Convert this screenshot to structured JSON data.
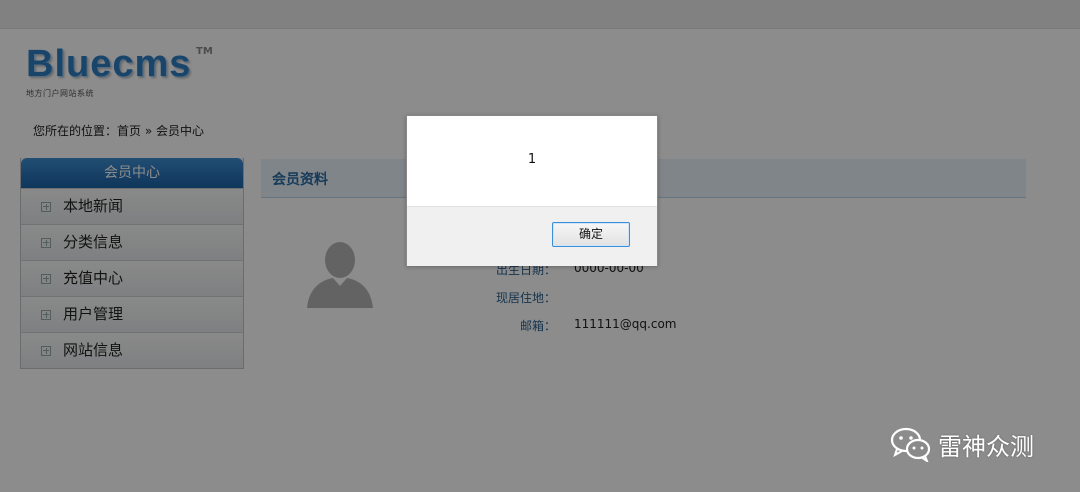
{
  "logo": {
    "name": "Bluecms",
    "tm": "TM",
    "subtitle": "地方门户网站系统"
  },
  "breadcrumb": "您所在的位置：首页 » 会员中心",
  "sidebar": {
    "title": "会员中心",
    "items": [
      {
        "label": "本地新闻"
      },
      {
        "label": "分类信息"
      },
      {
        "label": "充值中心"
      },
      {
        "label": "用户管理"
      },
      {
        "label": "网站信息"
      }
    ]
  },
  "profile": {
    "title": "会员资料",
    "fields": [
      {
        "label": "出生日期：",
        "value": "0000-00-00"
      },
      {
        "label": "现居住地：",
        "value": ""
      },
      {
        "label": "邮箱：",
        "value": "111111@qq.com"
      }
    ]
  },
  "dialog": {
    "message": "1",
    "ok_label": "确定"
  },
  "watermark": {
    "text": "雷神众测",
    "icon": "wechat-icon"
  }
}
